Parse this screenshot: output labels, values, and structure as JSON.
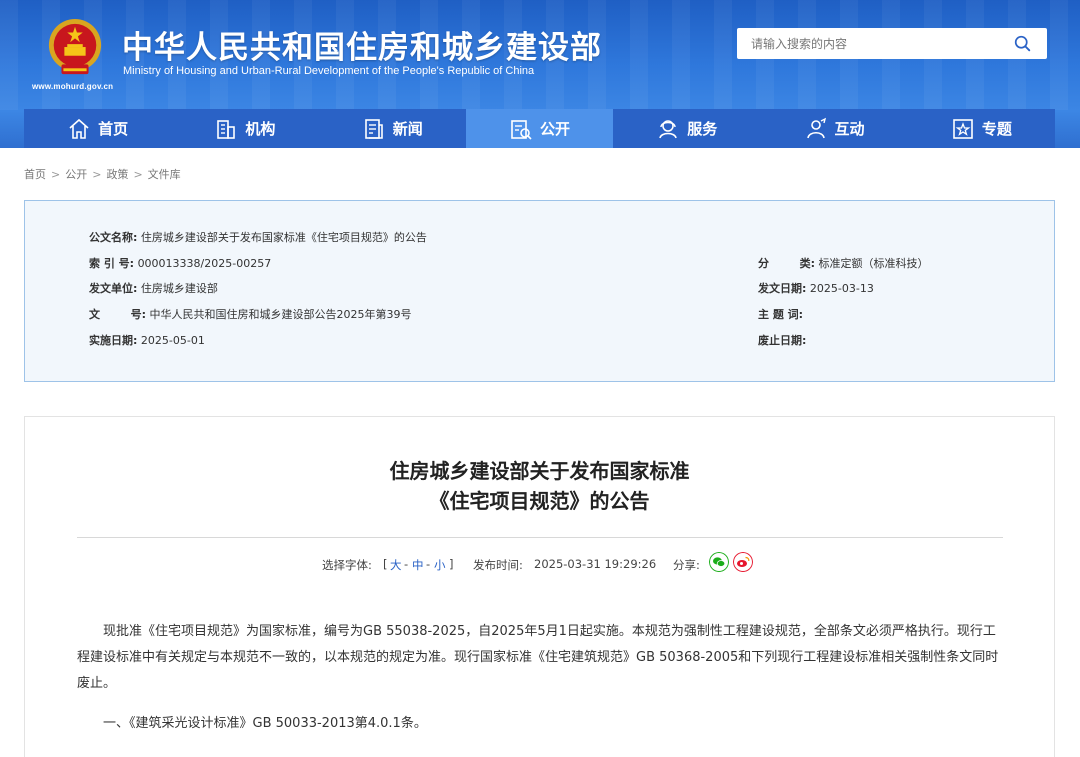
{
  "header": {
    "title": "中华人民共和国住房和城乡建设部",
    "subtitle": "Ministry of Housing and Urban-Rural Development of the People's Republic of China",
    "url": "www.mohurd.gov.cn",
    "search_placeholder": "请输入搜索的内容"
  },
  "nav": {
    "items": [
      {
        "label": "首页",
        "icon": "home-icon"
      },
      {
        "label": "机构",
        "icon": "building-icon"
      },
      {
        "label": "新闻",
        "icon": "news-icon"
      },
      {
        "label": "公开",
        "icon": "disclosure-icon"
      },
      {
        "label": "服务",
        "icon": "service-icon"
      },
      {
        "label": "互动",
        "icon": "interaction-icon"
      },
      {
        "label": "专题",
        "icon": "topic-icon"
      }
    ],
    "active": "公开"
  },
  "breadcrumb": [
    "首页",
    "公开",
    "政策",
    "文件库"
  ],
  "info": {
    "doc_name_label": "公文名称:",
    "doc_name": "住房城乡建设部关于发布国家标准《住宅项目规范》的公告",
    "index_label": "索 引 号:",
    "index": "000013338/2025-00257",
    "issuer_label": "发文单位:",
    "issuer": "住房城乡建设部",
    "doc_no_label": "文        号:",
    "doc_no": "中华人民共和国住房和城乡建设部公告2025年第39号",
    "effective_label": "实施日期:",
    "effective": "2025-05-01",
    "category_label": "分        类:",
    "category": "标准定额（标准科技）",
    "issue_date_label": "发文日期:",
    "issue_date": "2025-03-13",
    "keywords_label": "主 题 词:",
    "keywords": "",
    "abolish_label": "废止日期:",
    "abolish": ""
  },
  "article": {
    "title_line1": "住房城乡建设部关于发布国家标准",
    "title_line2": "《住宅项目规范》的公告",
    "font_size_label": "选择字体:",
    "bracket_open": "[",
    "font_large": "大",
    "font_mid": "中",
    "font_small": "小",
    "dash": "-",
    "bracket_close": "]",
    "publish_label": "发布时间:",
    "publish_time": "2025-03-31 19:29:26",
    "share_label": "分享:",
    "para1": "现批准《住宅项目规范》为国家标准，编号为GB 55038-2025，自2025年5月1日起实施。本规范为强制性工程建设规范，全部条文必须严格执行。现行工程建设标准中有关规定与本规范不一致的，以本规范的规定为准。现行国家标准《住宅建筑规范》GB 50368-2005和下列现行工程建设标准相关强制性条文同时废止。",
    "para2": "一、《建筑采光设计标准》GB 50033-2013第4.0.1条。"
  },
  "colors": {
    "header_blue": "#2f78dc",
    "nav_blue": "#2a62c6",
    "nav_active": "#4e92ea",
    "info_bg": "#f2f7fc",
    "info_border": "#9ec3e8",
    "wechat_green": "#1aad19",
    "weibo_red": "#e6162d"
  }
}
